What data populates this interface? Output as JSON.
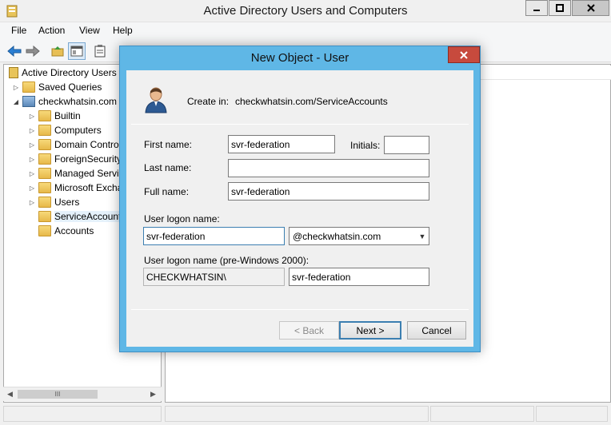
{
  "window": {
    "title": "Active Directory Users and Computers",
    "menu": [
      "File",
      "Action",
      "View",
      "Help"
    ]
  },
  "tree": {
    "root": "Active Directory Users",
    "items": [
      {
        "label": "Saved Queries",
        "level": 1,
        "expander": "▷"
      },
      {
        "label": "checkwhatsin.com",
        "level": 1,
        "expander": "◢"
      },
      {
        "label": "Builtin",
        "level": 2,
        "expander": "▷"
      },
      {
        "label": "Computers",
        "level": 2,
        "expander": "▷"
      },
      {
        "label": "Domain Contro",
        "level": 2,
        "expander": "▷"
      },
      {
        "label": "ForeignSecurity",
        "level": 2,
        "expander": "▷"
      },
      {
        "label": "Managed Servi",
        "level": 2,
        "expander": "▷"
      },
      {
        "label": "Microsoft Excha",
        "level": 2,
        "expander": "▷"
      },
      {
        "label": "Users",
        "level": 2,
        "expander": "▷"
      },
      {
        "label": "ServiceAccount",
        "level": 2,
        "expander": ""
      },
      {
        "label": "Accounts",
        "level": 2,
        "expander": ""
      }
    ],
    "scroll_thumb": "III"
  },
  "dialog": {
    "title": "New Object - User",
    "create_in_label": "Create in:",
    "create_in_path": "checkwhatsin.com/ServiceAccounts",
    "first_name_label": "First name:",
    "first_name_value": "svr-federation",
    "initials_label": "Initials:",
    "initials_value": "",
    "last_name_label": "Last name:",
    "last_name_value": "",
    "full_name_label": "Full name:",
    "full_name_value": "svr-federation",
    "logon_name_label": "User logon name:",
    "logon_name_value": "svr-federation",
    "upn_suffix": "@checkwhatsin.com",
    "pre2000_label": "User logon name (pre-Windows 2000):",
    "pre2000_domain": "CHECKWHATSIN\\",
    "pre2000_value": "svr-federation",
    "back_label": "< Back",
    "next_label": "Next >",
    "cancel_label": "Cancel"
  },
  "colors": {
    "dialog_frame": "#5fb7e6",
    "close_button": "#c74a3d",
    "default_button_border": "#3c7fb1"
  }
}
